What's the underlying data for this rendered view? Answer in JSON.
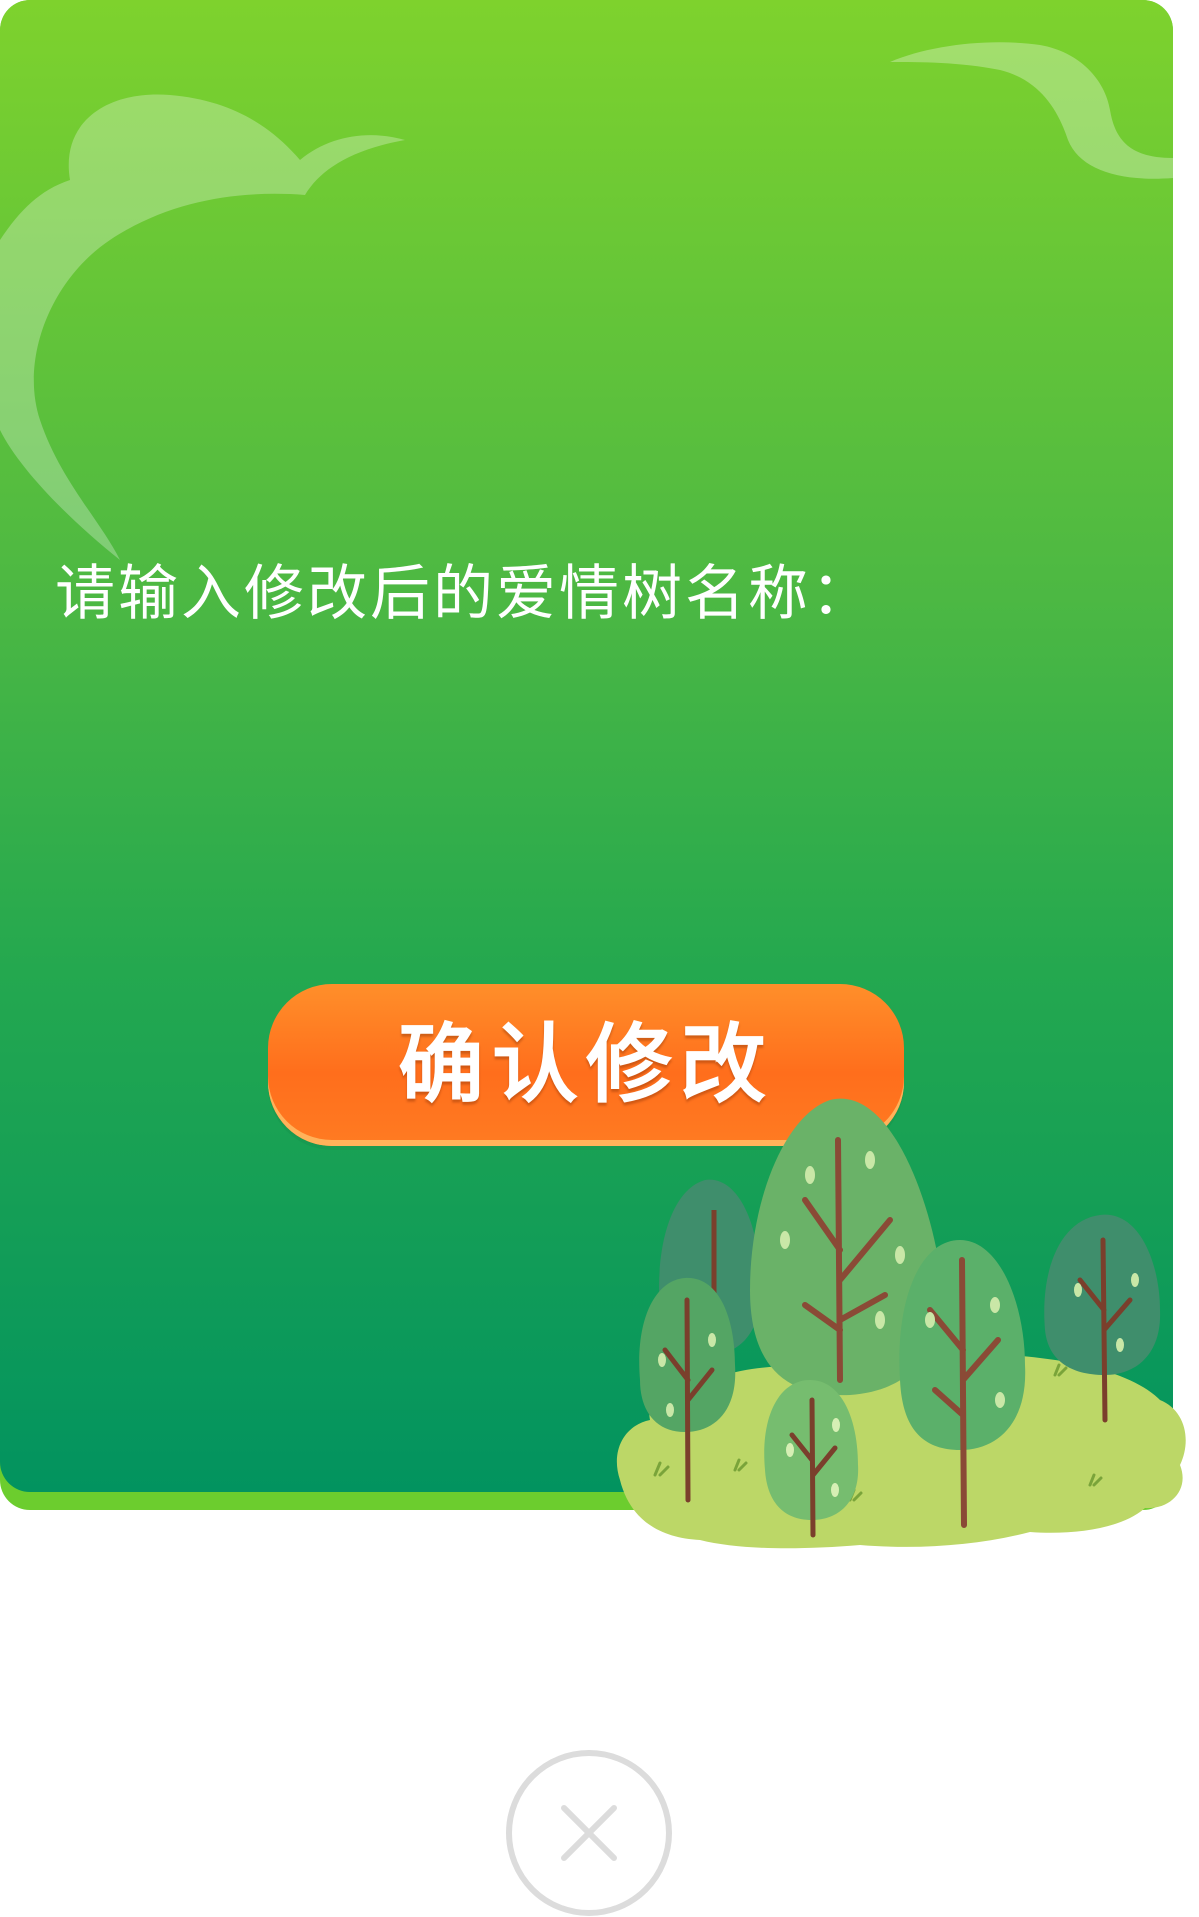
{
  "dialog": {
    "prompt_label": "请输入修改后的爱情树名称：",
    "name_input": {
      "value": "",
      "placeholder": ""
    },
    "confirm_button_label": "确认修改",
    "close_icon": "close-icon",
    "decoration_icons": [
      "cloud-icon",
      "forest-icon"
    ]
  },
  "colors": {
    "card_top": "#7ed22d",
    "card_bottom": "#02935f",
    "card_edge": "#6ccd2e",
    "button_orange": "#ff7b22",
    "close_ring": "#dcdcdc",
    "text": "#ffffff"
  }
}
